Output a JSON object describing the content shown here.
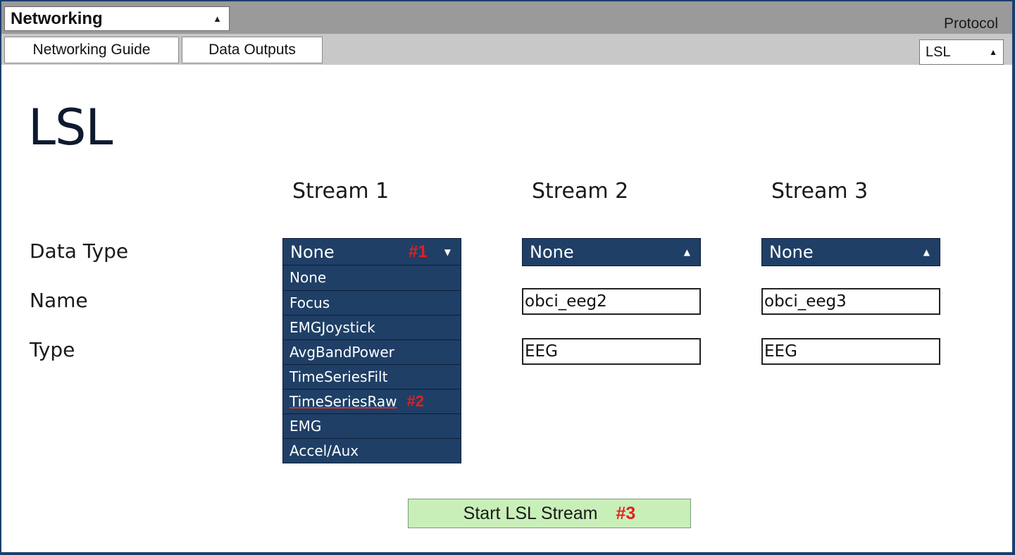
{
  "widget": {
    "selected": "Networking"
  },
  "protocol": {
    "label": "Protocol",
    "selected": "LSL"
  },
  "nav": {
    "guide_label": "Networking Guide",
    "outputs_label": "Data Outputs"
  },
  "page_title": "LSL",
  "streams": [
    {
      "header": "Stream 1",
      "data_type": "None",
      "annotation": "#1"
    },
    {
      "header": "Stream 2",
      "data_type": "None",
      "name": "obci_eeg2",
      "type": "EEG"
    },
    {
      "header": "Stream 3",
      "data_type": "None",
      "name": "obci_eeg3",
      "type": "EEG"
    }
  ],
  "row_labels": {
    "data_type": "Data Type",
    "name": "Name",
    "type": "Type"
  },
  "data_type_options": [
    {
      "label": "None"
    },
    {
      "label": "Focus"
    },
    {
      "label": "EMGJoystick"
    },
    {
      "label": "AvgBandPower"
    },
    {
      "label": "TimeSeriesFilt"
    },
    {
      "label": "TimeSeriesRaw",
      "annotation": "#2"
    },
    {
      "label": "EMG"
    },
    {
      "label": "Accel/Aux"
    }
  ],
  "start_button": {
    "label": "Start LSL Stream",
    "annotation": "#3"
  },
  "colors": {
    "dropdown_bg": "#1f3f66",
    "start_bg": "#c9efb9",
    "annotation": "#e02020",
    "frame": "#1a3f6e"
  }
}
